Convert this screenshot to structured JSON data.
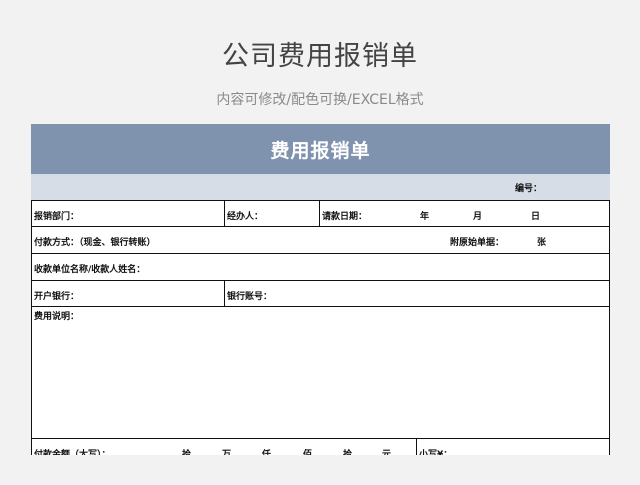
{
  "page": {
    "title": "公司费用报销单",
    "subtitle": "内容可修改/配色可换/EXCEL格式"
  },
  "form": {
    "header": "费用报销单",
    "serial_label": "编号：",
    "row1": {
      "dept": "报销部门：",
      "handler": "经办人：",
      "request_date": "请款日期：",
      "year": "年",
      "month": "月",
      "day": "日"
    },
    "row2": {
      "payment_method": "付款方式：（现金、银行转账）",
      "attachments": "附原始单据：",
      "sheets_unit": "张"
    },
    "row3": {
      "payee": "收款单位名称/收款人姓名："
    },
    "row4": {
      "bank": "开户银行：",
      "account": "银行账号："
    },
    "row5": {
      "description": "费用说明："
    },
    "row6": {
      "amount_upper": "付款金额（大写）：",
      "shi_wan": "拾",
      "wan": "万",
      "qian": "仟",
      "bai": "佰",
      "shi": "拾",
      "yuan": "元",
      "amount_lower": "小写¥："
    }
  }
}
